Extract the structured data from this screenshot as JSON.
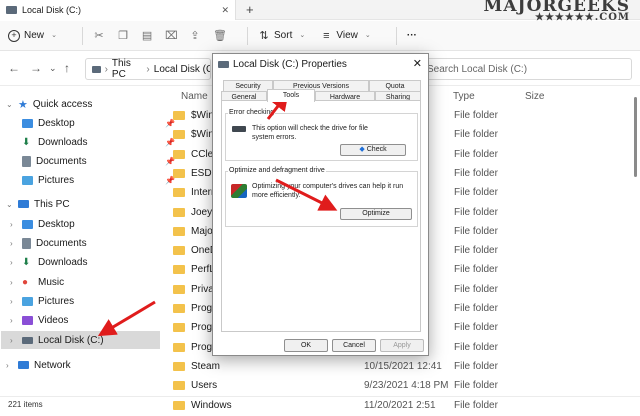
{
  "window": {
    "tab_title": "Local Disk (C:)",
    "tab_close": "✕",
    "new_tab": "+"
  },
  "watermark": {
    "line1": "MAJORGEEKS",
    "line2": "★★★★★★.COM"
  },
  "toolbar": {
    "new_label": "New",
    "sort_label": "Sort",
    "view_label": "View",
    "more_label": "···"
  },
  "address": {
    "this_pc": "This PC",
    "drive": "Local Disk (C:)",
    "search_placeholder": "Search Local Disk (C:)"
  },
  "sidebar": {
    "quick_access": "Quick access",
    "qa_items": [
      "Desktop",
      "Downloads",
      "Documents",
      "Pictures"
    ],
    "this_pc": "This PC",
    "pc_items": [
      "Desktop",
      "Documents",
      "Downloads",
      "Music",
      "Pictures",
      "Videos",
      "Local Disk (C:)"
    ],
    "network": "Network"
  },
  "columns": {
    "name": "Name",
    "type": "Type",
    "size": "Size"
  },
  "files": [
    {
      "name": "$Windows.~WS",
      "date": "",
      "type": "File folder"
    },
    {
      "name": "$WinREAgent",
      "date": "",
      "type": "File folder"
    },
    {
      "name": "CCleaner",
      "date": "",
      "type": "File folder"
    },
    {
      "name": "ESD",
      "date": "",
      "type": "File folder"
    },
    {
      "name": "Internet",
      "date": "",
      "type": "File folder"
    },
    {
      "name": "Joey",
      "date": "",
      "type": "File folder"
    },
    {
      "name": "MajorG",
      "date": "",
      "type": "File folder"
    },
    {
      "name": "OneDr",
      "date": "PM",
      "type": "File folder"
    },
    {
      "name": "PerfLo",
      "date": "",
      "type": "File folder"
    },
    {
      "name": "PrivaZ",
      "date": "AM",
      "type": "File folder"
    },
    {
      "name": "Progra",
      "date": "",
      "type": "File folder"
    },
    {
      "name": "Progra",
      "date": "PM",
      "type": "File folder"
    },
    {
      "name": "Progra",
      "date": "",
      "type": "File folder"
    },
    {
      "name": "Steam",
      "date": "10/15/2021 12:41",
      "type": "File folder"
    },
    {
      "name": "Users",
      "date": "9/23/2021 4:18 PM",
      "type": "File folder"
    },
    {
      "name": "Windows",
      "date": "11/20/2021 2:51",
      "type": "File folder"
    }
  ],
  "status": {
    "items": "221 items"
  },
  "dialog": {
    "title": "Local Disk (C:) Properties",
    "close": "✕",
    "tabs_row1": [
      "Security",
      "Previous Versions",
      "Quota"
    ],
    "tabs_row2": [
      "General",
      "Tools",
      "Hardware",
      "Sharing"
    ],
    "error_group": "Error checking",
    "error_desc": "This option will check the drive for file system errors.",
    "check_button": "Check",
    "opt_group": "Optimize and defragment drive",
    "opt_desc": "Optimizing your computer's drives can help it run more efficiently.",
    "optimize_button": "Optimize",
    "ok": "OK",
    "cancel": "Cancel",
    "apply": "Apply"
  },
  "colors": {
    "folder": "#f3c24b",
    "arrow": "#e01c1c",
    "selection": "#d9d9d9",
    "check_icon": "#1e6fd9"
  }
}
